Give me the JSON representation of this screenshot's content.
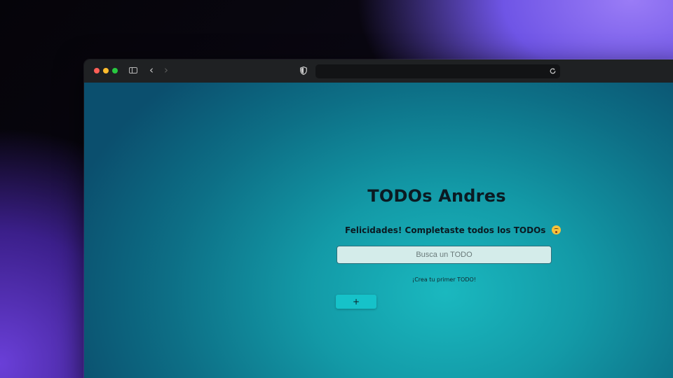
{
  "browser": {
    "address_bar": "",
    "icons": [
      "sidebar-toggle-icon",
      "chevron-left-icon",
      "chevron-right-icon",
      "shield-icon",
      "reload-icon"
    ]
  },
  "page": {
    "title": "TODOs Andres",
    "congrats_message": "Felicidades! Completaste todos los TODOs",
    "congrats_emoji": "kissing-face-icon",
    "search": {
      "placeholder": "Busca un TODO",
      "value": ""
    },
    "empty_hint": "¡Crea tu primer TODO!",
    "add_button_label": "+"
  },
  "colors": {
    "accent": "#16c2c9",
    "background_center": "#1ab8bf",
    "background_edge": "#0b4f6e",
    "text": "#0b1a22"
  }
}
